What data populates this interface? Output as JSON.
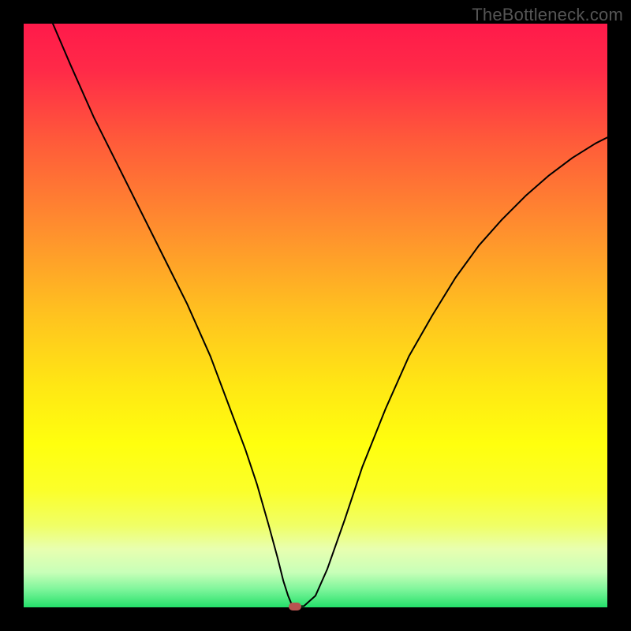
{
  "watermark": "TheBottleneck.com",
  "marker_color": "#b85450",
  "chart_data": {
    "type": "line",
    "title": "",
    "xlabel": "",
    "ylabel": "",
    "xlim": [
      0,
      100
    ],
    "ylim": [
      0,
      100
    ],
    "background": {
      "type": "vertical-gradient",
      "stops": [
        {
          "offset": 0.0,
          "color": "#ff1a4a"
        },
        {
          "offset": 0.08,
          "color": "#ff2a48"
        },
        {
          "offset": 0.2,
          "color": "#ff5a3a"
        },
        {
          "offset": 0.35,
          "color": "#ff8e2e"
        },
        {
          "offset": 0.5,
          "color": "#ffc31f"
        },
        {
          "offset": 0.62,
          "color": "#ffe714"
        },
        {
          "offset": 0.72,
          "color": "#ffff0e"
        },
        {
          "offset": 0.8,
          "color": "#fbff2a"
        },
        {
          "offset": 0.86,
          "color": "#f0ff66"
        },
        {
          "offset": 0.9,
          "color": "#e8ffb0"
        },
        {
          "offset": 0.94,
          "color": "#c8ffb8"
        },
        {
          "offset": 0.97,
          "color": "#7cf59a"
        },
        {
          "offset": 1.0,
          "color": "#24e06a"
        }
      ]
    },
    "series": [
      {
        "name": "curve",
        "color": "#000000",
        "stroke_width": 2,
        "x": [
          5,
          8,
          12,
          16,
          20,
          24,
          28,
          32,
          35,
          38,
          40,
          42,
          43.5,
          44.5,
          45.3,
          45.8,
          46.1,
          48,
          50,
          52,
          55,
          58,
          62,
          66,
          70,
          74,
          78,
          82,
          86,
          90,
          94,
          98,
          100
        ],
        "y": [
          100,
          93,
          84,
          76,
          68,
          60,
          52,
          43,
          35,
          27,
          21,
          14,
          8.5,
          4.5,
          2.0,
          0.8,
          0.2,
          0.2,
          2.0,
          6.5,
          15,
          24,
          34,
          43,
          50,
          56.5,
          62,
          66.5,
          70.5,
          74,
          77,
          79.5,
          80.5
        ]
      }
    ],
    "markers": [
      {
        "name": "minimum-marker",
        "x": 46.5,
        "y": 0.2,
        "color": "#b85450"
      }
    ]
  }
}
